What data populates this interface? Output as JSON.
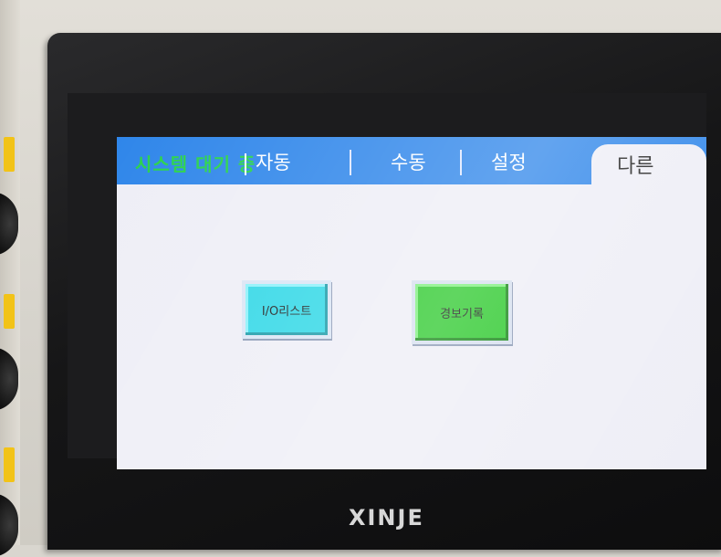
{
  "screen": {
    "status_text": "시스템 대기 중",
    "tabs": [
      {
        "label": "자동"
      },
      {
        "label": "수동"
      },
      {
        "label": "설정"
      }
    ],
    "active_tab_label": "다른",
    "buttons": {
      "io_list": "I/O리스트",
      "alarm_log": "경보기록"
    }
  },
  "device": {
    "brand": "XINJE"
  },
  "colors": {
    "tab_bar": "#2f86ea",
    "status_text": "#28d24a",
    "io_button": "#2ed7e6",
    "alarm_button": "#2bc92b",
    "screen_bg": "#eeeef6"
  }
}
